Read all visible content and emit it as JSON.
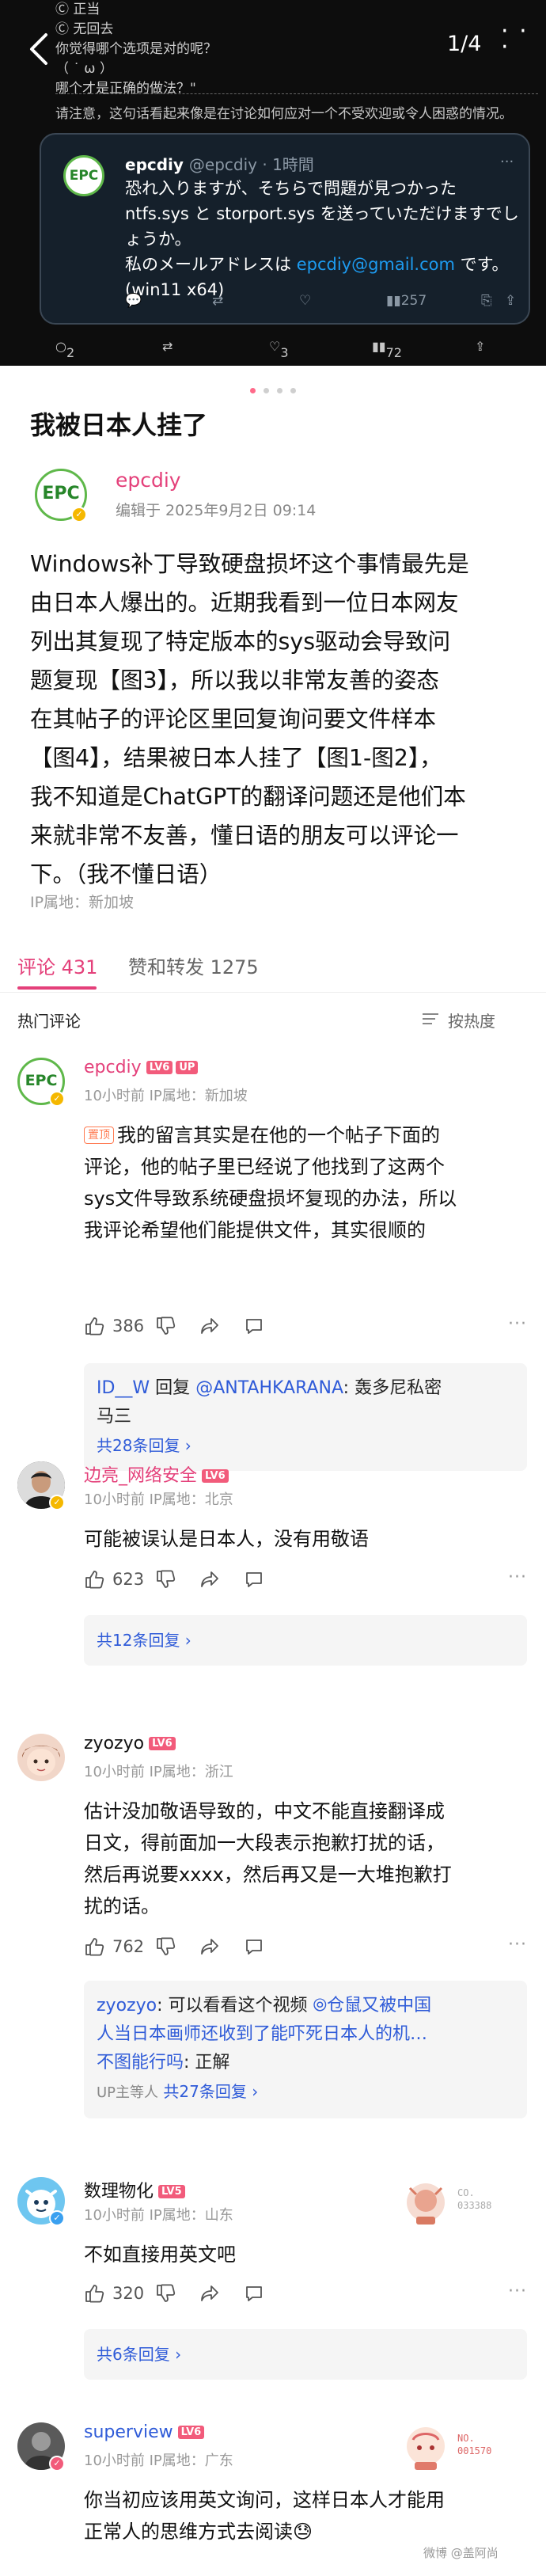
{
  "viewer": {
    "counter": "1/4",
    "shot_lines": [
      "Ⓒ 正当",
      "Ⓒ 无回去",
      "你觉得哪个选项是对的呢？",
      "（ ˙ ω ）",
      "哪个才是正确的做法？\""
    ],
    "notice": "请注意，这句话看起来像是在讨论如何应对一个不受欢迎或令人困惑的情况。",
    "tweet": {
      "name": "epcdiy",
      "handle": "@epcdiy · 1時間",
      "lines": [
        "恐れ入りますが、そちらで問題が見つかった",
        "ntfs.sys と storport.sys を送っていただけますでし",
        "ょうか。"
      ],
      "mail_prefix": "私のメールアドレスは ",
      "mail": "epcdiy@gmail.com",
      "mail_suffix": " です。",
      "last_line": "(win11 x64)",
      "views": "257"
    },
    "bottom": {
      "replies": "2",
      "likes": "3",
      "views": "72"
    }
  },
  "post": {
    "title": "我被日本人挂了",
    "author": "epcdiy",
    "edited": "编辑于 2025年9月2日 09:14",
    "body_lines": [
      "Windows补丁导致硬盘损坏这个事情最先是",
      "由日本人爆出的。近期我看到一位日本网友",
      "列出其复现了特定版本的sys驱动会导致问",
      "题复现【图3】，所以我以非常友善的姿态",
      "在其帖子的评论区里回复询问要文件样本",
      "【图4】，结果被日本人挂了【图1-图2】，",
      "我不知道是ChatGPT的翻译问题还是他们本",
      "来就非常不友善，懂日语的朋友可以评论一",
      "下。（我不懂日语）"
    ],
    "ip": "IP属地：新加坡"
  },
  "tabs": {
    "comments": "评论 431",
    "likes": "赞和转发 1275"
  },
  "sort": {
    "hot": "热门评论",
    "order": "按热度"
  },
  "comments": [
    {
      "name": "epcdiy",
      "level": "LV6",
      "up": "UP",
      "meta": "10小时前 IP属地：新加坡",
      "pin": "置顶",
      "lines": [
        "我的留言其实是在他的一个帖子下面的",
        "评论，他的帖子里已经说了他找到了这两个",
        "sys文件导致系统硬盘损坏复现的办法，所以",
        "我评论希望他们能提供文件，其实很顺的"
      ],
      "likes": "386",
      "reply_name": "ID__W",
      "reply_mid": " 回复 ",
      "reply_link": "@ANTAHKARANA",
      "reply_text": ": 轰多尼私密",
      "reply_text2": "马三",
      "total": "共28条回复 ›"
    },
    {
      "name": "边亮_网络安全",
      "level": "LV6",
      "meta": "10小时前 IP属地：北京",
      "lines": [
        "可能被误认是日本人，没有用敬语"
      ],
      "likes": "623",
      "total": "共12条回复 ›"
    },
    {
      "name": "zyozyo",
      "level": "LV6",
      "meta": "10小时前 IP属地：浙江",
      "lines": [
        "估计没加敬语导致的，中文不能直接翻译成",
        "日文，得前面加一大段表示抱歉打扰的话，",
        "然后再说要xxxx，然后再又是一大堆抱歉打",
        "扰的话。"
      ],
      "likes": "762",
      "reply_name": "zyozyo",
      "reply_text": ": 可以看看这个视频 ",
      "reply_link": "⦾仓鼠又被中国",
      "reply_line2": "人当日本画师还收到了能吓死日本人的机…",
      "reply_name2": "不图能行吗",
      "reply_text2": ": 正解",
      "sub": "UP主等人",
      "total": " 共27条回复 ›"
    },
    {
      "name": "数理物化",
      "level": "LV5",
      "meta": "10小时前 IP属地：山东",
      "medal_text": "CO.\n033388",
      "lines": [
        "不如直接用英文吧"
      ],
      "likes": "320",
      "total": "共6条回复 ›"
    },
    {
      "name": "superview",
      "level": "LV6",
      "meta": "10小时前 IP属地：广东",
      "medal_text": "NO.\n001570",
      "lines": [
        "你当初应该用英文询问，这样日本人才能用",
        "正常人的思维方式去阅读😓"
      ]
    }
  ],
  "watermark": "微博 @盖阿尚"
}
